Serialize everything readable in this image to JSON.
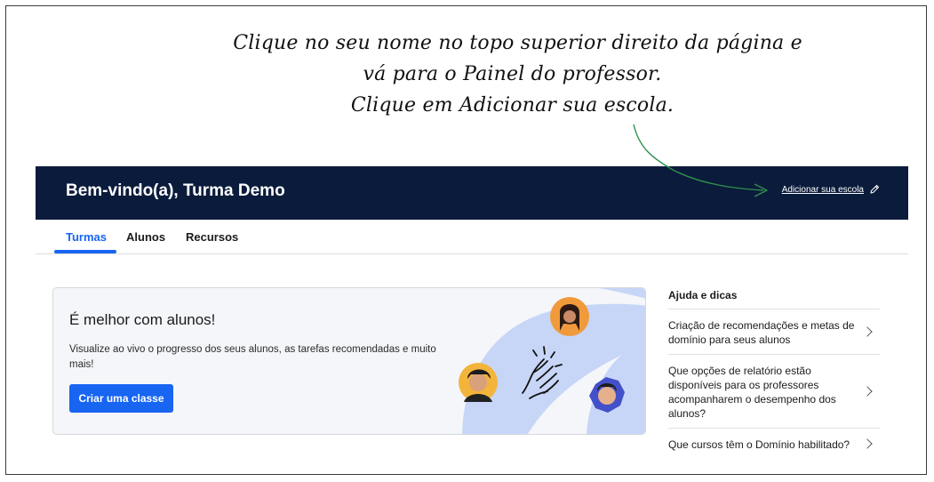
{
  "instruction": {
    "line1": "Clique no seu nome no topo superior direito da página e",
    "line2": "vá para o Painel do professor.",
    "line3": "Clique em Adicionar sua escola."
  },
  "header": {
    "title": "Bem-vindo(a), Turma Demo",
    "add_school_link": "Adicionar sua escola",
    "background_color": "#0b1b3b"
  },
  "tabs": [
    {
      "label": "Turmas",
      "active": true
    },
    {
      "label": "Alunos",
      "active": false
    },
    {
      "label": "Recursos",
      "active": false
    }
  ],
  "promo": {
    "title": "É melhor com alunos!",
    "text": "Visualize ao vivo o progresso dos seus alunos, as tarefas recomendadas e muito mais!",
    "button_label": "Criar uma classe",
    "accent_color": "#1865f2"
  },
  "help": {
    "title": "Ajuda e dicas",
    "items": [
      "Criação de recomendações e metas de domínio para seus alunos",
      "Que opções de relatório estão disponíveis para os professores acompanharem o desempenho dos alunos?",
      "Que cursos têm o Domínio habilitado?"
    ]
  },
  "icons": {
    "add_school": "pencil-icon",
    "help_item": "chevron-right-icon",
    "illustration": "high-five-hands-icon"
  }
}
